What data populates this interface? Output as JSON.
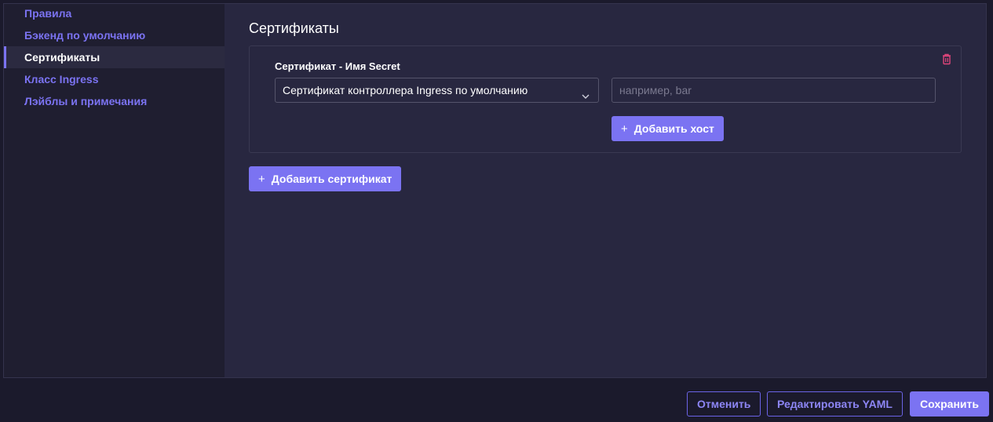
{
  "sidebar": {
    "items": [
      {
        "label": "Правила"
      },
      {
        "label": "Бэкенд по умолчанию"
      },
      {
        "label": "Сертификаты"
      },
      {
        "label": "Класс Ingress"
      },
      {
        "label": "Лэйблы и примечания"
      }
    ],
    "active_index": 2
  },
  "main": {
    "title": "Сертификаты",
    "certificate": {
      "label": "Сертификат - Имя Secret",
      "secret_select_value": "Сертификат контроллера Ingress по умолчанию",
      "host_input_value": "",
      "host_input_placeholder": "например, bar",
      "add_host_label": "Добавить хост",
      "remove_icon": "trash-icon"
    },
    "add_certificate_label": "Добавить сертификат"
  },
  "footer": {
    "cancel_label": "Отменить",
    "edit_yaml_label": "Редактировать YAML",
    "save_label": "Сохранить"
  },
  "colors": {
    "accent": "#7b73f2",
    "danger": "#e0457b",
    "background": "#282740",
    "sidebar": "#1f1e30"
  }
}
